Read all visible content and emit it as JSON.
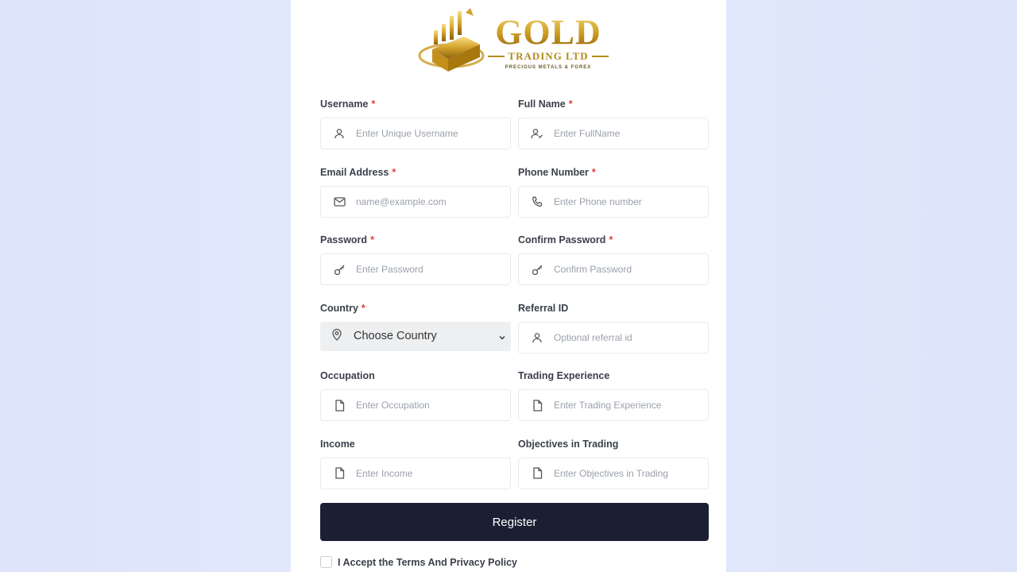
{
  "logo": {
    "brand": "GOLD",
    "subtitle": "TRADING LTD",
    "tagline": "PRECIOUS METALS & FOREX"
  },
  "form": {
    "username": {
      "label": "Username",
      "required": "*",
      "placeholder": "Enter Unique Username",
      "value": "",
      "icon": "user-icon"
    },
    "fullname": {
      "label": "Full Name",
      "required": "*",
      "placeholder": "Enter FullName",
      "value": "",
      "icon": "user-check-icon"
    },
    "email": {
      "label": "Email Address",
      "required": "*",
      "placeholder": "name@example.com",
      "value": "",
      "icon": "mail-icon"
    },
    "phone": {
      "label": "Phone Number",
      "required": "*",
      "placeholder": "Enter Phone number",
      "value": "",
      "icon": "phone-icon"
    },
    "password": {
      "label": "Password",
      "required": "*",
      "placeholder": "Enter Password",
      "value": "",
      "icon": "key-icon"
    },
    "confirm_password": {
      "label": "Confirm Password",
      "required": "*",
      "placeholder": "Confirm Password",
      "value": "",
      "icon": "key-icon"
    },
    "country": {
      "label": "Country",
      "required": "*",
      "selected": "Choose Country",
      "icon": "map-pin-icon"
    },
    "referral": {
      "label": "Referral ID",
      "placeholder": "Optional referral id",
      "value": "",
      "icon": "user-icon"
    },
    "occupation": {
      "label": "Occupation",
      "placeholder": "Enter Occupation",
      "value": "",
      "icon": "file-icon"
    },
    "trading_experience": {
      "label": "Trading Experience",
      "placeholder": "Enter Trading Experience",
      "value": "",
      "icon": "file-icon"
    },
    "income": {
      "label": "Income",
      "placeholder": "Enter Income",
      "value": "",
      "icon": "file-icon"
    },
    "objectives": {
      "label": "Objectives in Trading",
      "placeholder": "Enter Objectives in Trading",
      "value": "",
      "icon": "file-icon"
    }
  },
  "register_label": "Register",
  "terms_label": "I Accept the Terms And Privacy Policy",
  "colors": {
    "page_bg": "#e2e8fb",
    "card_bg": "#ffffff",
    "button_bg": "#1b1f33",
    "required": "#e0403a",
    "gold": "#c9a12a"
  }
}
